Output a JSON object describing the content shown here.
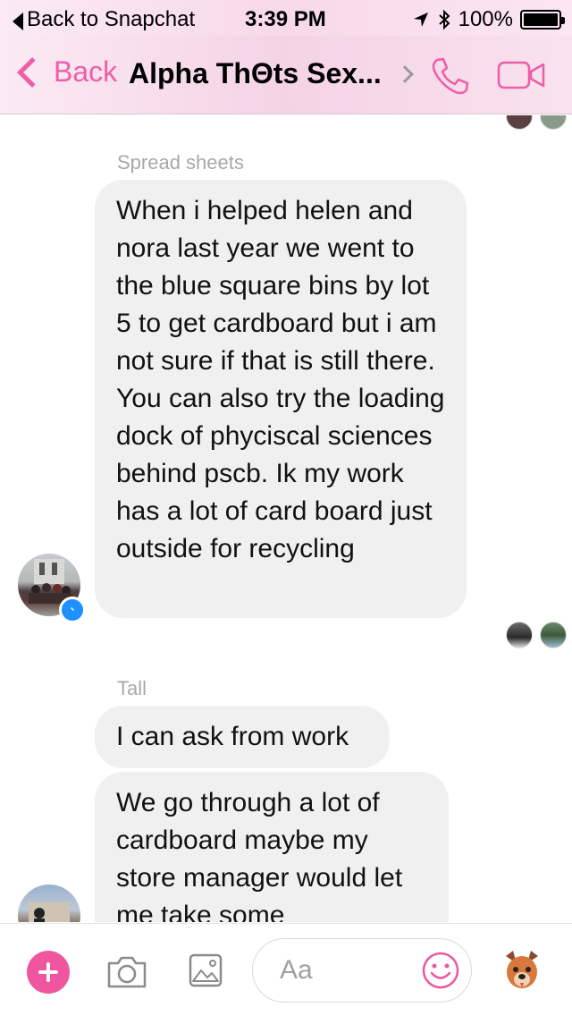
{
  "status_bar": {
    "back_app": "Back to Snapchat",
    "time": "3:39 PM",
    "battery": "100%"
  },
  "nav": {
    "back_label": "Back",
    "title": "Alpha ThΘts Sex...",
    "phone_icon": "phone-icon",
    "video_icon": "video-camera-icon"
  },
  "messages": [
    {
      "sender": "Spread sheets",
      "bubbles": [
        "When i helped helen and nora last year we went to the blue square bins by lot 5 to get cardboard but i am not sure if that is still there. You can also try the loading dock of phyciscal sciences behind pscb. Ik my work has a lot of card board just outside for recycling"
      ]
    },
    {
      "sender": "Tall",
      "bubbles": [
        "I can ask from work",
        "We go through a lot of cardboard maybe my store manager would let me take some"
      ]
    }
  ],
  "composer": {
    "placeholder": "Aa"
  },
  "colors": {
    "accent": "#ee5da7",
    "plus": "#f0569f",
    "bubble": "#f0f0f0",
    "messenger_badge": "#1e90ff"
  }
}
